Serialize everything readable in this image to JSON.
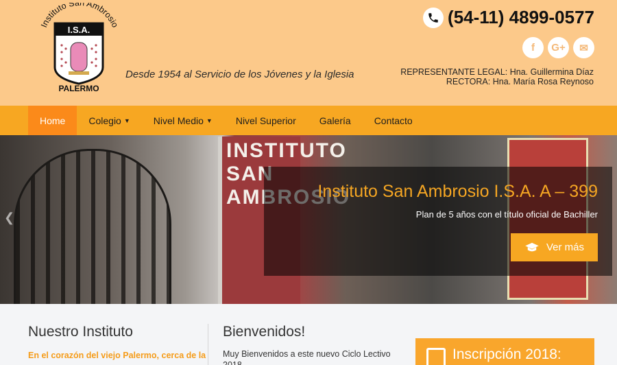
{
  "header": {
    "logo": {
      "arc_text": "Instituto San Ambrosio",
      "shield_text": "I.S.A.",
      "bottom_text": "PALERMO"
    },
    "tagline": "Desde 1954 al Servicio de los Jóvenes y la Iglesia",
    "phone": "(54-11) 4899-0577",
    "social": [
      "f",
      "G+",
      "✉"
    ],
    "legal_rep": "REPRESENTANTE LEGAL: Hna. Guillermina Díaz",
    "rectora": "RECTORA: Hna. María Rosa Reynoso"
  },
  "nav": {
    "items": [
      {
        "label": "Home",
        "active": true,
        "dropdown": false
      },
      {
        "label": "Colegio",
        "active": false,
        "dropdown": true
      },
      {
        "label": "Nivel Medio",
        "active": false,
        "dropdown": true
      },
      {
        "label": "Nivel Superior",
        "active": false,
        "dropdown": false
      },
      {
        "label": "Galería",
        "active": false,
        "dropdown": false
      },
      {
        "label": "Contacto",
        "active": false,
        "dropdown": false
      }
    ]
  },
  "hero": {
    "sign_text": "INSTITUTO SAN AMBROSIO",
    "title": "Instituto San Ambrosio I.S.A. A – 399",
    "subtitle": "Plan de 5 años con el título oficial de Bachiller",
    "button": "Ver más"
  },
  "sections": {
    "nuestro_instituto": {
      "title": "Nuestro Instituto",
      "lead": "En el corazón del viejo Palermo, cerca de la"
    },
    "bienvenidos": {
      "title": "Bienvenidos!",
      "lead": "Muy Bienvenidos a este nuevo Ciclo Lectivo 2018"
    },
    "inscripcion": {
      "title": "Inscripción 2018:"
    }
  },
  "colors": {
    "header_bg": "#fcc98a",
    "nav_bg": "#f7a722",
    "nav_active": "#fb8a1a",
    "accent": "#f5a623"
  }
}
